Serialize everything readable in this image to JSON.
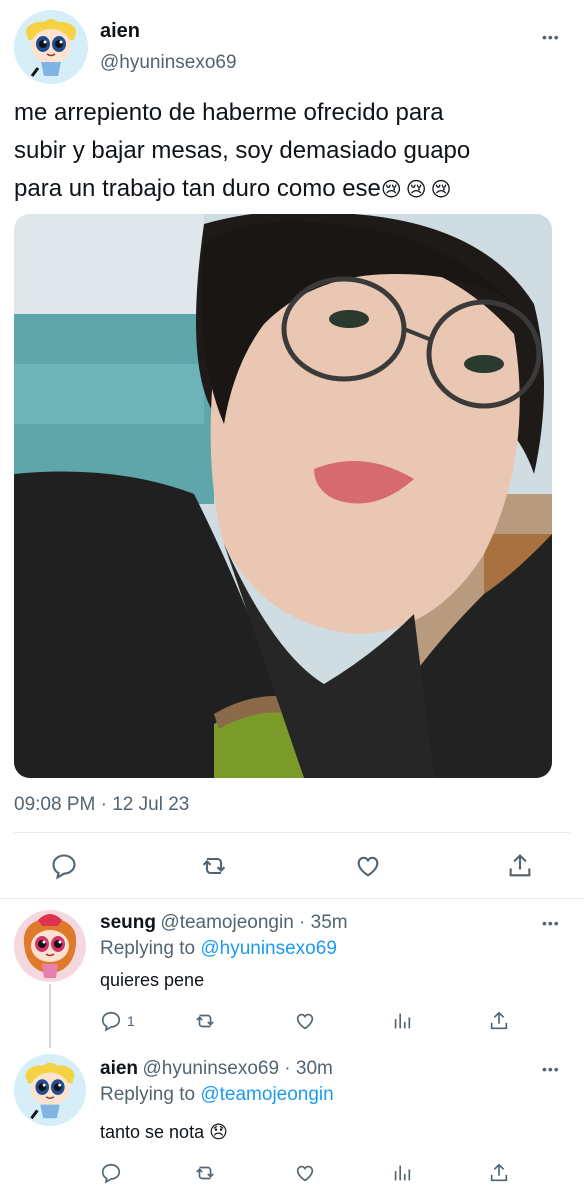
{
  "main_tweet": {
    "name": "aien",
    "handle": "@hyuninsexo69",
    "text_line1": "me arrepiento de haberme ofrecido para",
    "text_line2": "subir y bajar mesas, soy demasiado guapo",
    "text_line3": "para un trabajo tan duro como ese",
    "emojis": "😢😢😢",
    "timestamp": "09:08 PM · 12 Jul 23",
    "more": "•••"
  },
  "replies": [
    {
      "name": "seung",
      "meta": "@teamojeongin · 35m",
      "replying_prefix": "Replying to",
      "replying_handle": "@hyuninsexo69",
      "text": "quieres pene",
      "reply_count": "1",
      "more": "•••"
    },
    {
      "name": "aien",
      "meta": "@hyuninsexo69 · 30m",
      "replying_prefix": "Replying to",
      "replying_handle": "@teamojeongin",
      "text": "tanto se nota 😞",
      "more": "•••"
    }
  ],
  "colors": {
    "link": "#1d9bf0",
    "secondary_text": "#536471",
    "divider": "#e6ecf0"
  },
  "icons": [
    "reply-icon",
    "retweet-icon",
    "like-icon",
    "share-icon",
    "analytics-icon",
    "more-icon"
  ]
}
